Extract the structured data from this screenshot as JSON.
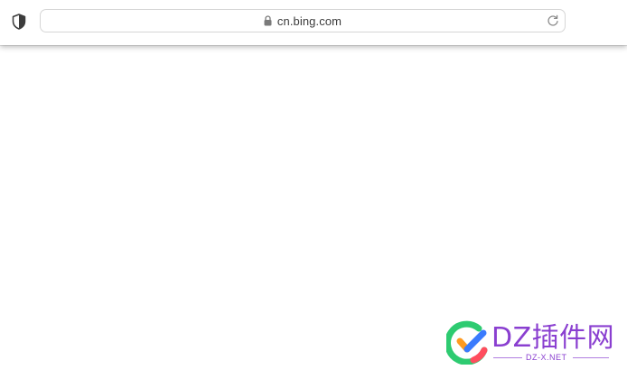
{
  "browser": {
    "url": "cn.bing.com",
    "icons": {
      "privacy": "shield-half-icon",
      "security": "lock-icon",
      "reload": "reload-icon"
    }
  },
  "watermark": {
    "title": "DZ插件网",
    "subtitle": "DZ-X.NET",
    "colors": {
      "text": "#8a3fd0",
      "ring_green": "#2ecb71",
      "ring_red": "#ff4d5e",
      "check_orange": "#ff9a1f",
      "check_blue": "#3a7bfd"
    }
  }
}
